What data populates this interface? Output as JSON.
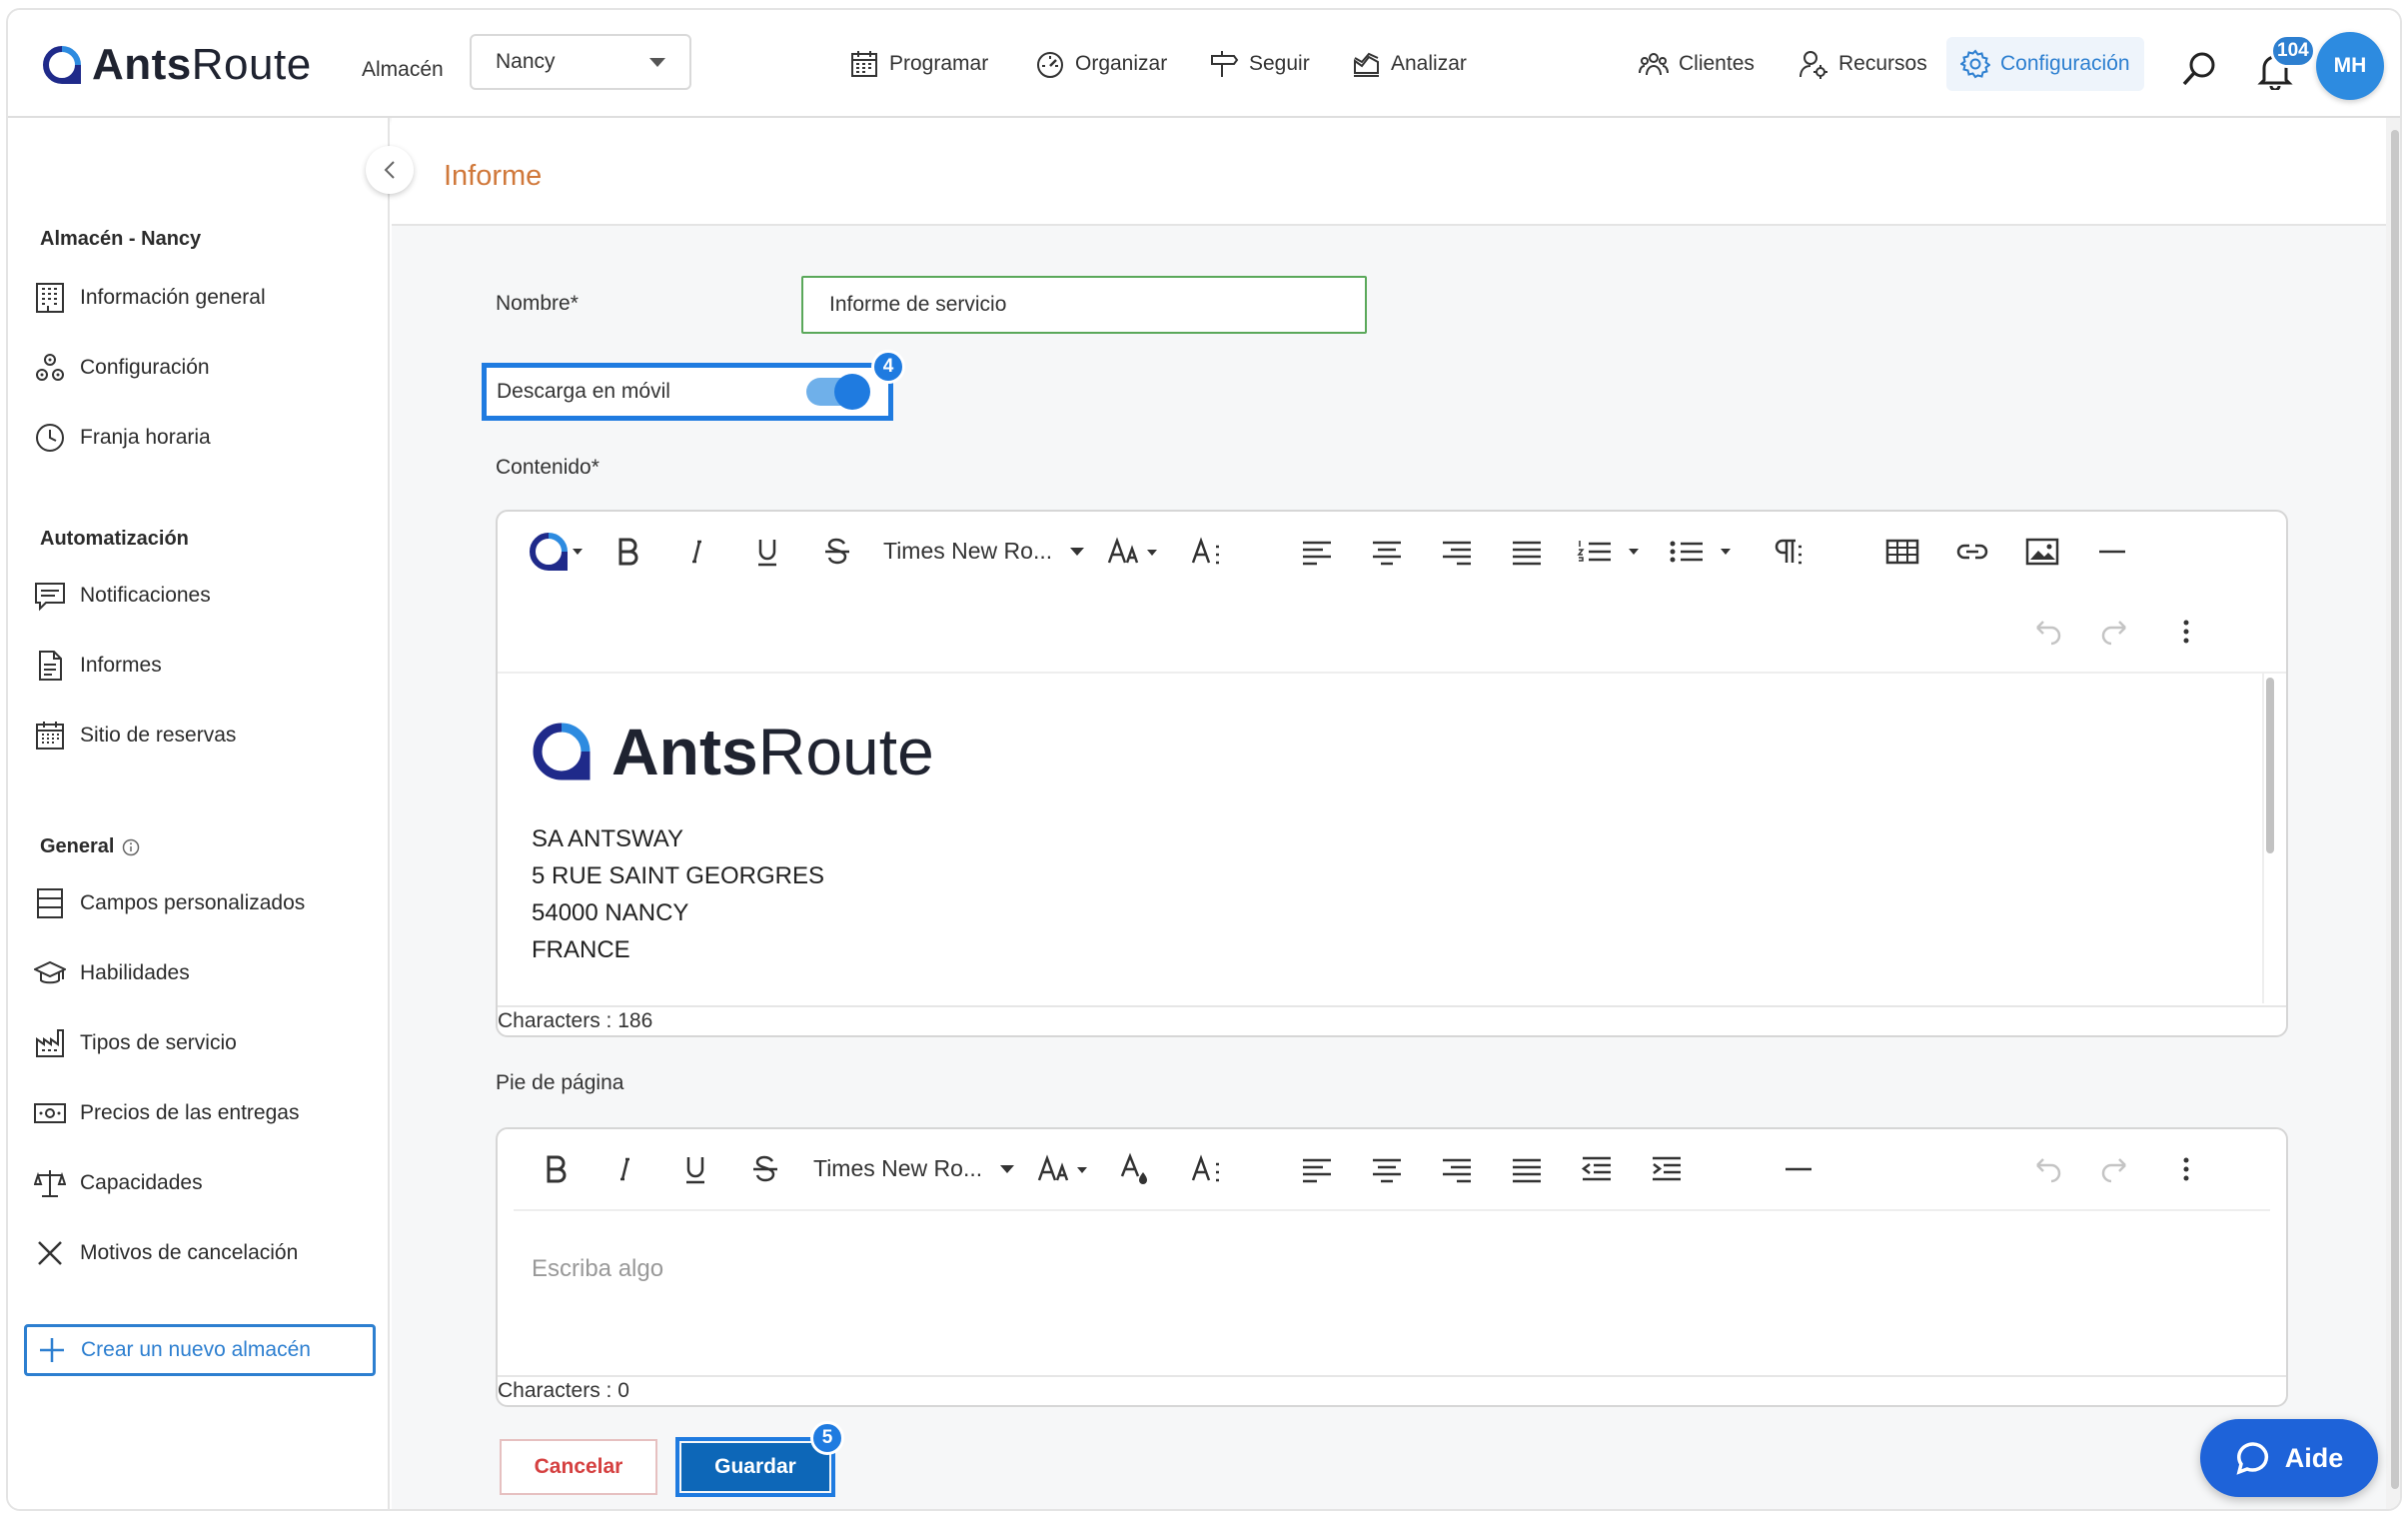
{
  "app": {
    "logo_bold": "Ants",
    "logo_light": "Route"
  },
  "header": {
    "warehouse_label": "Almacén",
    "warehouse_value": "Nancy",
    "nav": [
      {
        "label": "Programar",
        "icon": "calendar-icon"
      },
      {
        "label": "Organizar",
        "icon": "gauge-icon"
      },
      {
        "label": "Seguir",
        "icon": "signpost-icon"
      },
      {
        "label": "Analizar",
        "icon": "chart-icon"
      },
      {
        "label": "Clientes",
        "icon": "customers-icon"
      },
      {
        "label": "Recursos",
        "icon": "user-gear-icon"
      },
      {
        "label": "Configuración",
        "icon": "gear-icon",
        "active": true
      }
    ],
    "notification_count": "104",
    "avatar_initials": "MH"
  },
  "sidebar": {
    "section_warehouse": "Almacén - Nancy",
    "warehouse_items": [
      {
        "label": "Información general"
      },
      {
        "label": "Configuración"
      },
      {
        "label": "Franja horaria"
      }
    ],
    "section_automation": "Automatización",
    "automation_items": [
      {
        "label": "Notificaciones"
      },
      {
        "label": "Informes"
      },
      {
        "label": "Sitio de reservas"
      }
    ],
    "section_general": "General",
    "general_items": [
      {
        "label": "Campos personalizados"
      },
      {
        "label": "Habilidades"
      },
      {
        "label": "Tipos de servicio"
      },
      {
        "label": "Precios de las entregas"
      },
      {
        "label": "Capacidades"
      },
      {
        "label": "Motivos de cancelación"
      }
    ],
    "new_warehouse": "Crear un nuevo almacén"
  },
  "main": {
    "title": "Informe",
    "name_label": "Nombre*",
    "name_value": "Informe de servicio",
    "mobile_download_label": "Descarga en móvil",
    "mobile_download_on": true,
    "step_toggle": "4",
    "content_label": "Contenido*",
    "content_editor": {
      "font": "Times New Ro...",
      "logo_bold": "Ants",
      "logo_light": "Route",
      "address": [
        "SA ANTSWAY",
        "5 RUE SAINT GEORGRES",
        "54000 NANCY",
        "FRANCE"
      ],
      "char_count": "Characters : 186"
    },
    "footer_label": "Pie de página",
    "footer_editor": {
      "font": "Times New Ro...",
      "placeholder": "Escriba algo",
      "char_count": "Characters : 0"
    },
    "cancel_label": "Cancelar",
    "save_label": "Guardar",
    "step_save": "5"
  },
  "help": {
    "label": "Aide"
  },
  "colors": {
    "accent": "#2d7fd0",
    "title_orange": "#d0783a",
    "save_button": "#0d67b8",
    "cancel_text": "#d54040",
    "highlight": "#1f7be0"
  }
}
